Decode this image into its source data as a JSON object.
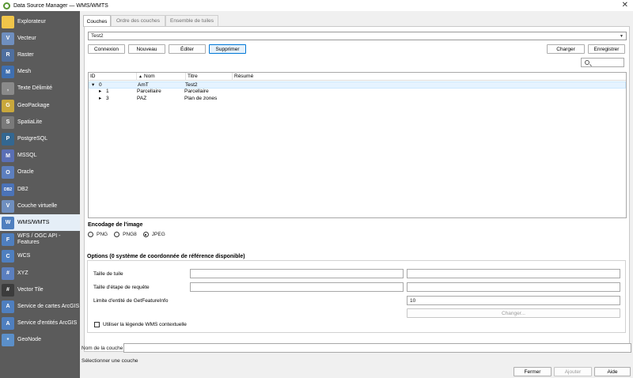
{
  "window": {
    "title": "Data Source Manager — WMS/WMTS",
    "close_glyph": "✕"
  },
  "sidebar": {
    "items": [
      {
        "label": "Explorateur",
        "icon": "folder-icon",
        "color": "#f0c54a",
        "glyph": ""
      },
      {
        "label": "Vecteur",
        "icon": "vector-icon",
        "color": "#6f8fbf",
        "glyph": "V"
      },
      {
        "label": "Raster",
        "icon": "raster-icon",
        "color": "#4f6f9f",
        "glyph": "R"
      },
      {
        "label": "Mesh",
        "icon": "mesh-icon",
        "color": "#3f6fb0",
        "glyph": "M"
      },
      {
        "label": "Texte Délimité",
        "icon": "delimited-text-icon",
        "color": "#8a8a8a",
        "glyph": ","
      },
      {
        "label": "GeoPackage",
        "icon": "geopackage-icon",
        "color": "#c9a83c",
        "glyph": "G"
      },
      {
        "label": "SpatiaLite",
        "icon": "spatialite-icon",
        "color": "#7a7a7a",
        "glyph": "S"
      },
      {
        "label": "PostgreSQL",
        "icon": "postgresql-icon",
        "color": "#336791",
        "glyph": "P"
      },
      {
        "label": "MSSQL",
        "icon": "mssql-icon",
        "color": "#5a6fb5",
        "glyph": "M"
      },
      {
        "label": "Oracle",
        "icon": "oracle-icon",
        "color": "#5d7fbf",
        "glyph": "O"
      },
      {
        "label": "DB2",
        "icon": "db2-icon",
        "color": "#4b73b8",
        "glyph": "DB2"
      },
      {
        "label": "Couche virtuelle",
        "icon": "virtual-layer-icon",
        "color": "#6f8fbf",
        "glyph": "V"
      },
      {
        "label": "WMS/WMTS",
        "icon": "wms-globe-icon",
        "color": "#4f7fbf",
        "glyph": "W"
      },
      {
        "label": "WFS / OGC API - Features",
        "icon": "wfs-globe-icon",
        "color": "#4f7fbf",
        "glyph": "F"
      },
      {
        "label": "WCS",
        "icon": "wcs-globe-icon",
        "color": "#4f7fbf",
        "glyph": "C"
      },
      {
        "label": "XYZ",
        "icon": "xyz-grid-icon",
        "color": "#5b7fbf",
        "glyph": "#"
      },
      {
        "label": "Vector Tile",
        "icon": "vector-tile-icon",
        "color": "#3c3c3c",
        "glyph": "#"
      },
      {
        "label": "Service de cartes ArcGIS",
        "icon": "arcgis-map-icon",
        "color": "#4f7fbf",
        "glyph": "A"
      },
      {
        "label": "Service d'entités ArcGIS",
        "icon": "arcgis-feature-icon",
        "color": "#4f7fbf",
        "glyph": "A"
      },
      {
        "label": "GeoNode",
        "icon": "geonode-icon",
        "color": "#5b8fc9",
        "glyph": "*"
      }
    ]
  },
  "tabs": [
    {
      "label": "Couches",
      "active": true
    },
    {
      "label": "Ordre des couches",
      "active": false
    },
    {
      "label": "Ensemble de tuiles",
      "active": false
    }
  ],
  "connection": {
    "selected": "Test2"
  },
  "buttons": {
    "connexion": "Connexion",
    "nouveau": "Nouveau",
    "editer": "Éditer",
    "supprimer": "Supprimer",
    "charger": "Charger",
    "enregistrer": "Enregistrer",
    "changer": "Changer...",
    "fermer": "Fermer",
    "ajouter": "Ajouter",
    "aide": "Aide"
  },
  "layers_table": {
    "columns": [
      "ID",
      "Nom",
      "Titre",
      "Résumé"
    ],
    "rows": [
      {
        "expander": "▾",
        "id": "0",
        "name": "AmT",
        "title": "Test2",
        "abstract": ""
      },
      {
        "expander": "▸",
        "id": "1",
        "name": "Parcellaire",
        "title": "Parcellaire",
        "abstract": ""
      },
      {
        "expander": "▸",
        "id": "3",
        "name": "PAZ",
        "title": "Plan de zones",
        "abstract": ""
      }
    ]
  },
  "image_encoding": {
    "label": "Encodage de l'image",
    "options": [
      "PNG",
      "PNG8",
      "JPEG"
    ],
    "selected": "JPEG"
  },
  "options": {
    "label": "Options (0 système de coordonnée de référence disponible)",
    "tile_size_label": "Taille de tuile",
    "request_step_label": "Taille d'étape de requête",
    "feature_limit_label": "Limite d'entité de GetFeatureInfo",
    "feature_limit_value": "10",
    "contextual_legend_label": "Utiliser la légende WMS contextuelle"
  },
  "layer_name_label": "Nom de la couche",
  "status": "Sélectionner une couche"
}
